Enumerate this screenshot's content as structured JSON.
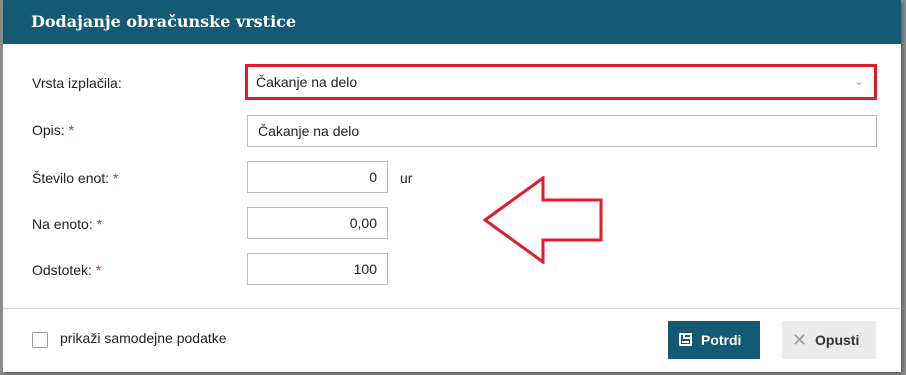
{
  "dialog": {
    "title": "Dodajanje obračunske vrstice"
  },
  "form": {
    "vrsta": {
      "label": "Vrsta izplačila:",
      "value": "Čakanje na delo"
    },
    "opis": {
      "label": "Opis:",
      "required": "*",
      "value": "Čakanje na delo"
    },
    "stevilo": {
      "label": "Število enot:",
      "required": "*",
      "value": "0",
      "unit": "ur"
    },
    "na_enoto": {
      "label": "Na enoto:",
      "required": "*",
      "value": "0,00"
    },
    "odstotek": {
      "label": "Odstotek:",
      "required": "*",
      "value": "100"
    }
  },
  "footer": {
    "checkbox_label": "prikaži samodejne podatke",
    "confirm_label": "Potrdi",
    "cancel_label": "Opusti"
  },
  "colors": {
    "header": "#145a75",
    "highlight": "#dd1e2a",
    "required": "#d9262b"
  },
  "icons": {
    "select_chevron": "chevron-down-icon",
    "confirm": "save-icon",
    "cancel": "close-icon",
    "annotation": "arrow-left-icon"
  }
}
